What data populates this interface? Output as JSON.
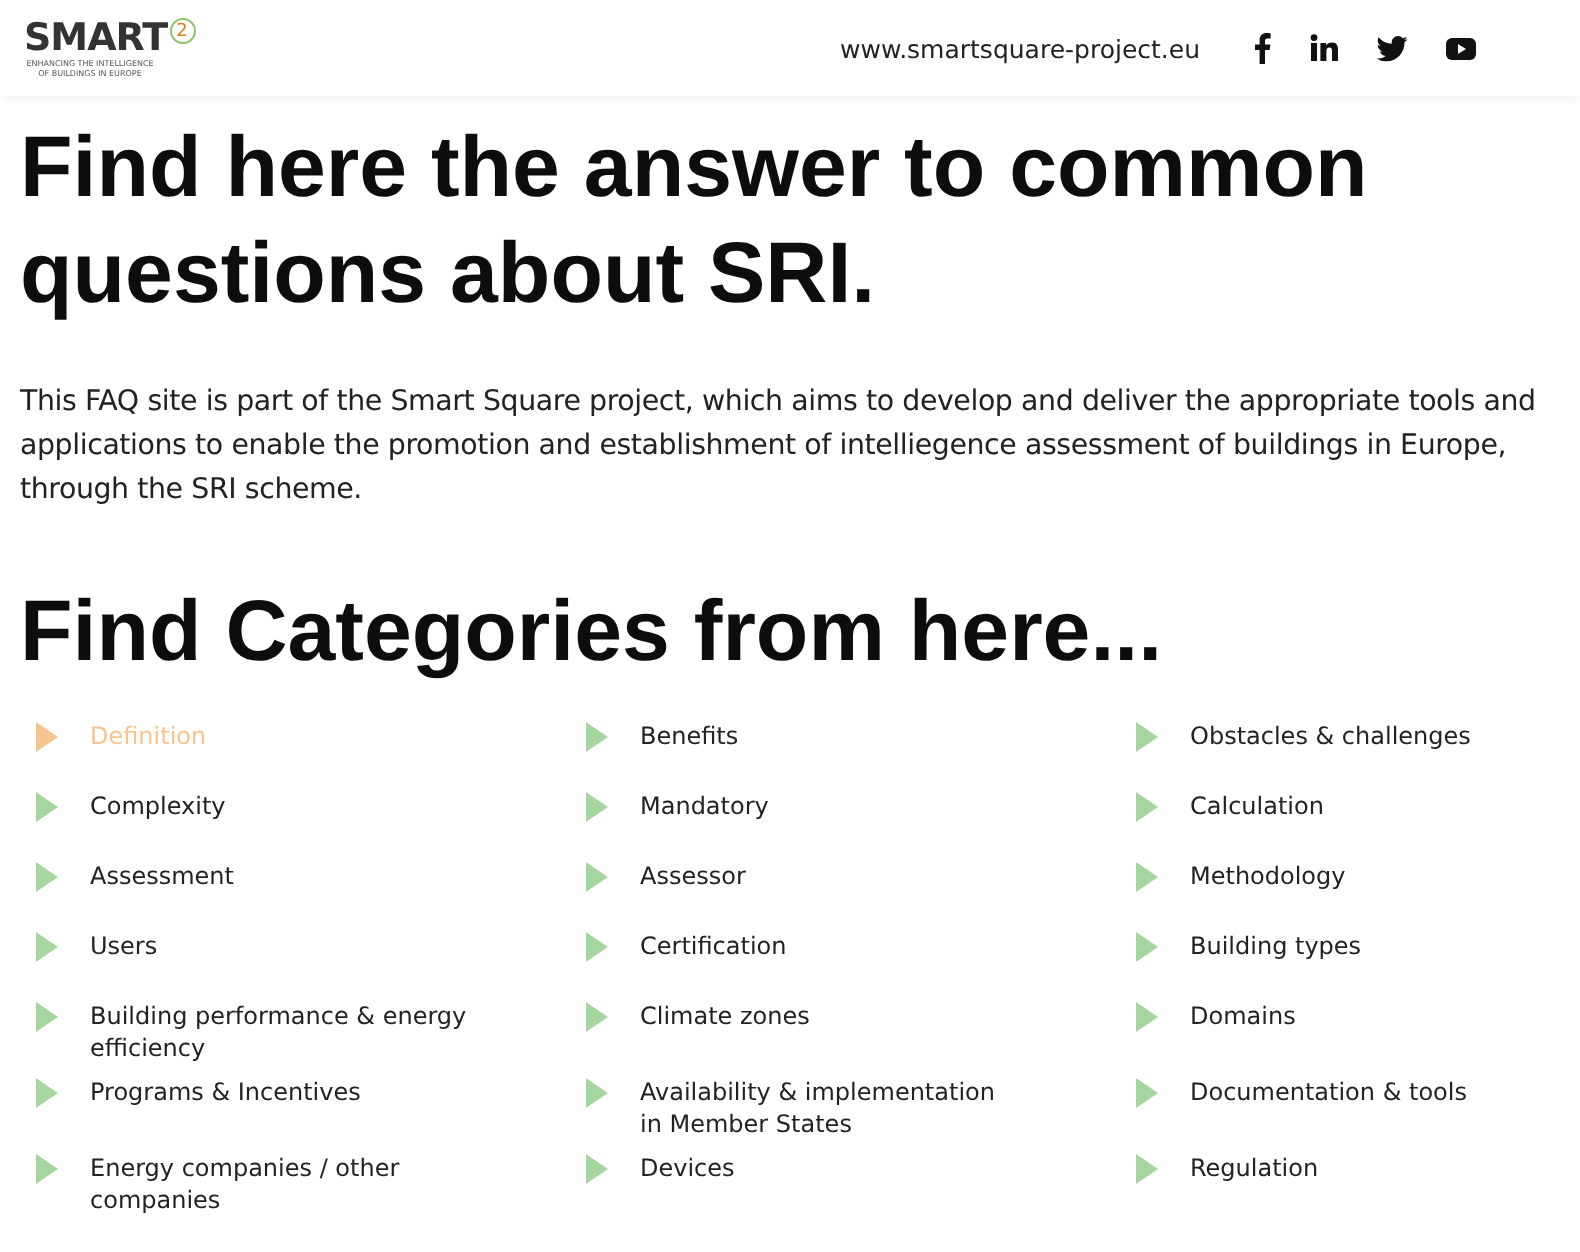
{
  "header": {
    "logo": {
      "name": "SMART",
      "mark": "2",
      "tagline": "ENHANCING THE INTELLIGENCE OF BUILDINGS IN EUROPE"
    },
    "website": "www.smartsquare-project.eu",
    "social": [
      {
        "kind": "facebook"
      },
      {
        "kind": "linkedin"
      },
      {
        "kind": "twitter"
      },
      {
        "kind": "youtube"
      }
    ]
  },
  "title": "Find here the answer to common questions about SRI.",
  "intro": "This FAQ site is part of the Smart Square project, which aims to develop and deliver the appropriate tools and applications to enable the promotion and establishment of intelliegence assessment of buildings in Europe, through the SRI scheme.",
  "categories_heading": "Find Categories from here...",
  "categories": [
    {
      "label": "Definition",
      "selected": true
    },
    {
      "label": "Benefits",
      "selected": false
    },
    {
      "label": "Obstacles & challenges",
      "selected": false
    },
    {
      "label": "Complexity",
      "selected": false
    },
    {
      "label": "Mandatory",
      "selected": false
    },
    {
      "label": "Calculation",
      "selected": false
    },
    {
      "label": "Assessment",
      "selected": false
    },
    {
      "label": "Assessor",
      "selected": false
    },
    {
      "label": "Methodology",
      "selected": false
    },
    {
      "label": "Users",
      "selected": false
    },
    {
      "label": "Certification",
      "selected": false
    },
    {
      "label": "Building types",
      "selected": false
    },
    {
      "label": "Building performance & energy efficiency",
      "selected": false
    },
    {
      "label": "Climate zones",
      "selected": false
    },
    {
      "label": "Domains",
      "selected": false
    },
    {
      "label": "Programs & Incentives",
      "selected": false
    },
    {
      "label": "Availability & implementation in Member States",
      "selected": false
    },
    {
      "label": "Documentation & tools",
      "selected": false
    },
    {
      "label": "Energy companies / other companies",
      "selected": false
    },
    {
      "label": "Devices",
      "selected": false
    },
    {
      "label": "Regulation",
      "selected": false
    }
  ]
}
